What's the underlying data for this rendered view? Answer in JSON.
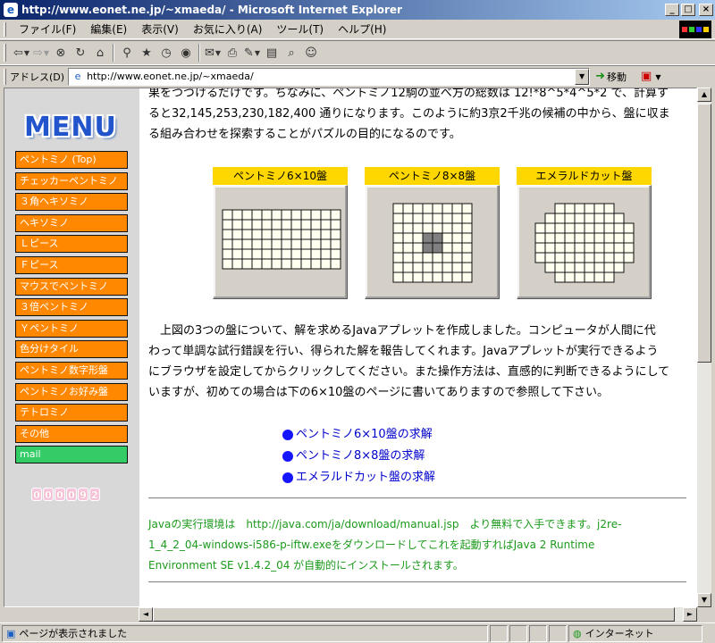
{
  "window": {
    "title": "http://www.eonet.ne.jp/~xmaeda/ - Microsoft Internet Explorer",
    "btn_min": "_",
    "btn_max": "□",
    "btn_close": "×"
  },
  "menubar": [
    "ファイル(F)",
    "編集(E)",
    "表示(V)",
    "お気に入り(A)",
    "ツール(T)",
    "ヘルプ(H)"
  ],
  "toolbar": {
    "icons": [
      "back-arrow-icon",
      "forward-arrow-icon",
      "stop-icon",
      "refresh-icon",
      "home-icon",
      "search-icon",
      "favorites-icon",
      "history-icon",
      "mail-icon",
      "print-icon",
      "edit-icon",
      "discuss-icon",
      "messenger-icon"
    ]
  },
  "address": {
    "label": "アドレス(D)",
    "url": "http://www.eonet.ne.jp/~xmaeda/",
    "go_label": "移動"
  },
  "sidebar": {
    "logo": "MENU",
    "items": [
      {
        "label": "ペントミノ (Top)"
      },
      {
        "label": "チェッカーペントミノ"
      },
      {
        "label": "３角ヘキソミノ"
      },
      {
        "label": "ヘキソミノ"
      },
      {
        "label": "Ｌピース"
      },
      {
        "label": "Ｆピース"
      },
      {
        "label": "マウスでペントミノ"
      },
      {
        "label": "３倍ペントミノ"
      },
      {
        "label": "Ｙペントミノ"
      },
      {
        "label": " 色分けタイル"
      },
      {
        "label": "ペントミノ数字形盤"
      },
      {
        "label": "ペントミノお好み盤"
      },
      {
        "label": "テトロミノ"
      },
      {
        "label": "その他"
      },
      {
        "label": "mail"
      }
    ],
    "counter": [
      "0",
      "0",
      "0",
      "0",
      "9",
      "2"
    ]
  },
  "main": {
    "intro_lines": [
      "果をつづけるだけです。ちなみに、ペントミノ12駒の並べ方の総数は 12!*8^5*4^5*2 で、計算す",
      "ると32,145,253,230,182,400 通りになります。このように約3京2千兆の候補の中から、盤に収ま",
      "る組み合わせを探索することがパズルの目的になるのです。"
    ],
    "boards": [
      {
        "label": "ペントミノ6×10盤"
      },
      {
        "label": "ペントミノ8×8盤"
      },
      {
        "label": "エメラルドカット盤"
      }
    ],
    "desc_lines": [
      "　上図の3つの盤について、解を求めるJavaアプレットを作成しました。コンピュータが人間に代",
      "わって単調な試行錯誤を行い、得られた解を報告してくれます。Javaアプレットが実行できるよう",
      "にブラウザを設定してからクリックしてください。また操作方法は、直感的に判断できるようにして",
      "いますが、初めての場合は下の6×10盤のページに書いてありますので参照して下さい。"
    ],
    "links": [
      {
        "label": "ペントミノ6×10盤の求解"
      },
      {
        "label": "ペントミノ8×8盤の求解"
      },
      {
        "label": "エメラルドカット盤の求解"
      }
    ],
    "java_note_lines": [
      "Javaの実行環境は　http://java.com/ja/download/manual.jsp　より無料で入手できます。j2re-",
      "1_4_2_04-windows-i586-p-iftw.exeをダウンロードしてこれを起動すればJava 2 Runtime",
      "Environment SE v1.4.2_04 が自動的にインストールされます。"
    ]
  },
  "status": {
    "text": "ページが表示されました",
    "zone": "インターネット"
  },
  "colors": {
    "menu_orange": "#ff8800",
    "mail_green": "#33cc66",
    "board_label_yellow": "#ffd700",
    "link_blue": "#0000cc",
    "note_green": "#1c9a1c"
  }
}
